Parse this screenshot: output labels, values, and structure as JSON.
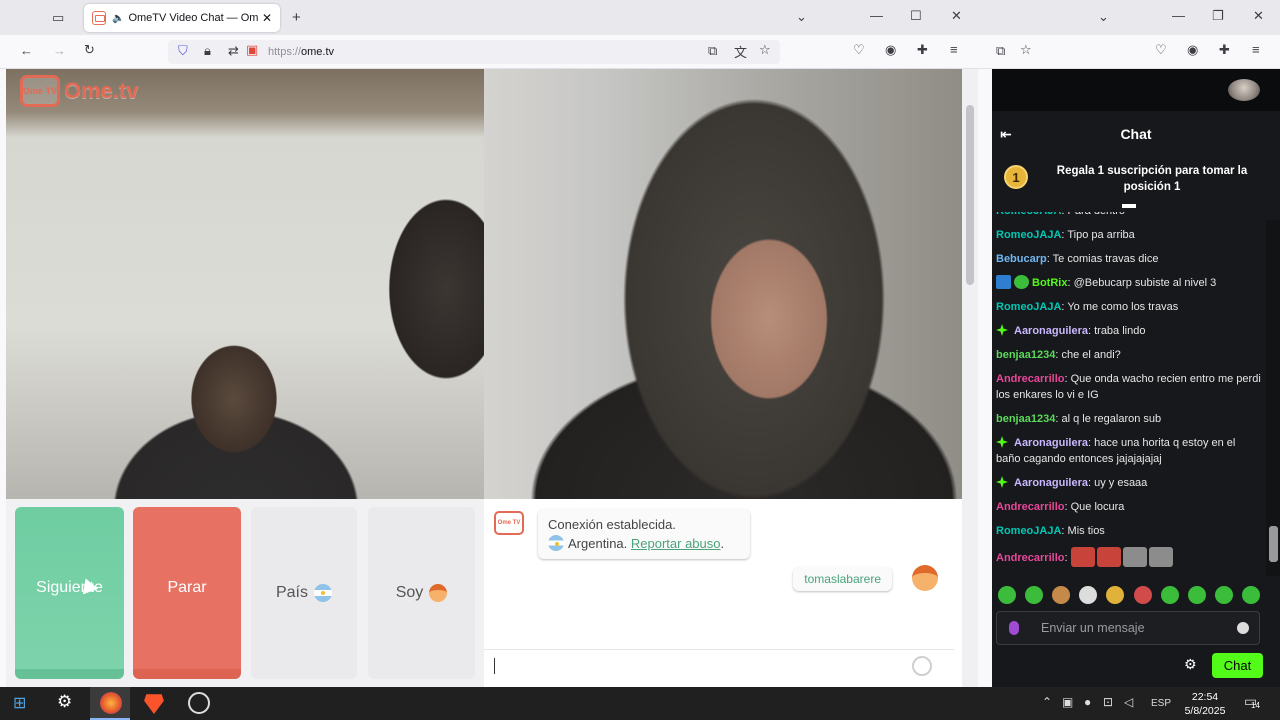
{
  "browser": {
    "tab_title": "OmeTV Video Chat — Ome",
    "tab_close": "✕",
    "new_tab": "+",
    "url_proto": "https://",
    "url_host": "ome.tv"
  },
  "ometv": {
    "logo_badge": "Ome TV",
    "logo_text": "Ome.tv",
    "next_label": "Siguiente",
    "stop_label": "Parar",
    "country_label": "País",
    "soy_label": "Soy",
    "system_message": "Conexión establecida.",
    "country_name": "Argentina.",
    "report_link": "Reportar abuso",
    "report_suffix": ".",
    "my_username": "tomaslabarere"
  },
  "chat": {
    "title": "Chat",
    "sub_banner_rank": "1",
    "sub_banner_text": "Regala 1 suscripción para tomar la posición 1",
    "messages": [
      {
        "user": "RomeoJAJA",
        "color": "#00c8b4",
        "text": "Para dentro"
      },
      {
        "user": "RomeoJAJA",
        "color": "#00c8b4",
        "text": "Tipo pa arriba"
      },
      {
        "user": "Bebucarp",
        "color": "#6fb8f5",
        "text": "Te comias travas dice"
      },
      {
        "user": "BotRix",
        "color": "#53fc18",
        "text": "@Bebucarp subiste al nivel 3"
      },
      {
        "user": "RomeoJAJA",
        "color": "#00c8b4",
        "text": "Yo me como los travas"
      },
      {
        "user": "Aaronaguilera",
        "color": "#c9b8ff",
        "text": "traba lindo"
      },
      {
        "user": "benjaa1234",
        "color": "#5ad85a",
        "text": "che el andi?"
      },
      {
        "user": "Andrecarrillo",
        "color": "#e8479a",
        "text": "Que onda wacho recien entro me perdi los enkares lo vi e IG"
      },
      {
        "user": "benjaa1234",
        "color": "#5ad85a",
        "text": "al q le regalaron sub"
      },
      {
        "user": "Aaronaguilera",
        "color": "#c9b8ff",
        "text": "hace una horita q estoy en el baño cagando entonces jajajajajaj"
      },
      {
        "user": "Aaronaguilera",
        "color": "#c9b8ff",
        "text": "uy y esaaa"
      },
      {
        "user": "Andrecarrillo",
        "color": "#e8479a",
        "text": "Que locura"
      },
      {
        "user": "RomeoJAJA",
        "color": "#00c8b4",
        "text": "Mis tios"
      },
      {
        "user": "Andrecarrillo",
        "color": "#e8479a",
        "text": ""
      }
    ],
    "input_placeholder": "Enviar un mensaje",
    "send_label": "Chat"
  },
  "taskbar": {
    "lang": "ESP",
    "time": "22:54",
    "date": "5/8/2025",
    "notif_count": "14"
  },
  "colors": {
    "next_green": "#7dd3ab",
    "stop_red": "#e77263",
    "kick_green": "#53fc18",
    "ome_orange": "#e36a55"
  }
}
